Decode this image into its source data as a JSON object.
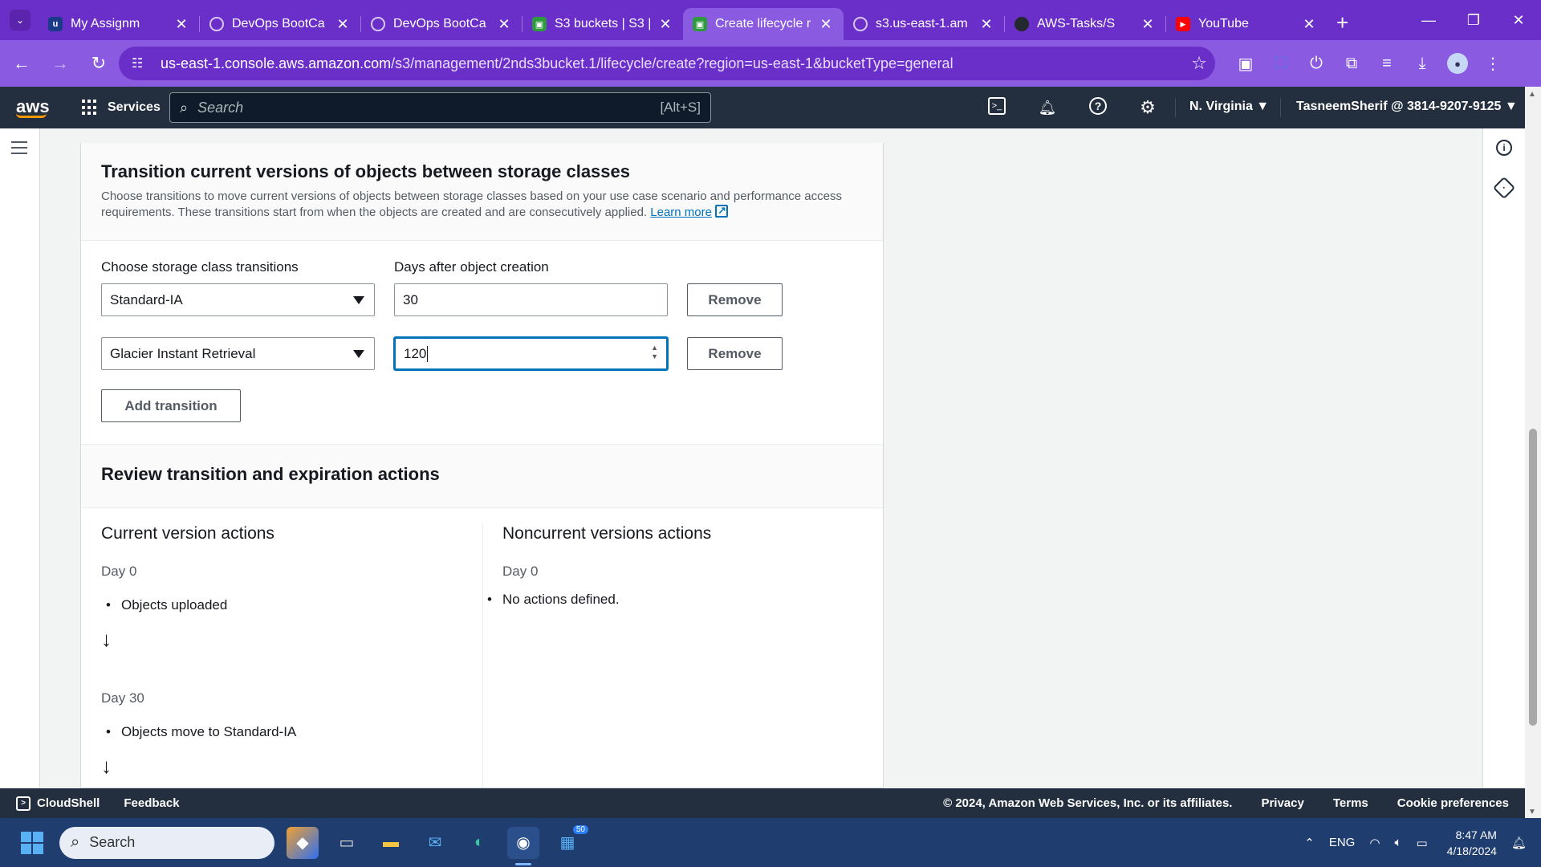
{
  "browser": {
    "tabs": [
      {
        "title": "My Assignm",
        "icon": "uc-favicon-icon",
        "active": false
      },
      {
        "title": "DevOps BootCa",
        "icon": "web-favicon-icon",
        "active": false
      },
      {
        "title": "DevOps BootCa",
        "icon": "web-favicon-icon",
        "active": false
      },
      {
        "title": "S3 buckets | S3 |",
        "icon": "s3-favicon-icon",
        "active": false
      },
      {
        "title": "Create lifecycle r",
        "icon": "s3-favicon-icon",
        "active": true
      },
      {
        "title": "s3.us-east-1.am",
        "icon": "web-favicon-icon",
        "active": false
      },
      {
        "title": "AWS-Tasks/S",
        "icon": "github-favicon-icon",
        "active": false
      },
      {
        "title": "YouTube",
        "icon": "youtube-favicon-icon",
        "active": false
      }
    ],
    "url_domain": "us-east-1.console.aws.amazon.com",
    "url_path": "/s3/management/2nds3bucket.1/lifecycle/create?region=us-east-1&bucketType=general"
  },
  "aws_nav": {
    "logo": "aws",
    "services_label": "Services",
    "search_placeholder": "Search",
    "search_shortcut": "[Alt+S]",
    "region": "N. Virginia ▼",
    "account": "TasneemSherif @ 3814-9207-9125 ▼"
  },
  "transition_section": {
    "title": "Transition current versions of objects between storage classes",
    "description": "Choose transitions to move current versions of objects between storage classes based on your use case scenario and performance access requirements. These transitions start from when the objects are created and are consecutively applied.",
    "learn_more": "Learn more",
    "storage_class_label": "Choose storage class transitions",
    "days_label": "Days after object creation",
    "rows": [
      {
        "storage_class": "Standard-IA",
        "days": "30",
        "remove_label": "Remove"
      },
      {
        "storage_class": "Glacier Instant Retrieval",
        "days": "120",
        "remove_label": "Remove"
      }
    ],
    "add_transition_label": "Add transition"
  },
  "review_section": {
    "title": "Review transition and expiration actions",
    "current": {
      "heading": "Current version actions",
      "day0": "Day 0",
      "day0_item": "Objects uploaded",
      "day30": "Day 30",
      "day30_item": "Objects move to Standard-IA"
    },
    "noncurrent": {
      "heading": "Noncurrent versions actions",
      "day0": "Day 0",
      "note": "No actions defined."
    }
  },
  "footer": {
    "cloudshell": "CloudShell",
    "feedback": "Feedback",
    "copyright": "© 2024, Amazon Web Services, Inc. or its affiliates.",
    "privacy": "Privacy",
    "terms": "Terms",
    "cookies": "Cookie preferences"
  },
  "taskbar": {
    "search_placeholder": "Search",
    "language": "ENG",
    "time": "8:47 AM",
    "date": "4/18/2024",
    "badge": "50"
  }
}
